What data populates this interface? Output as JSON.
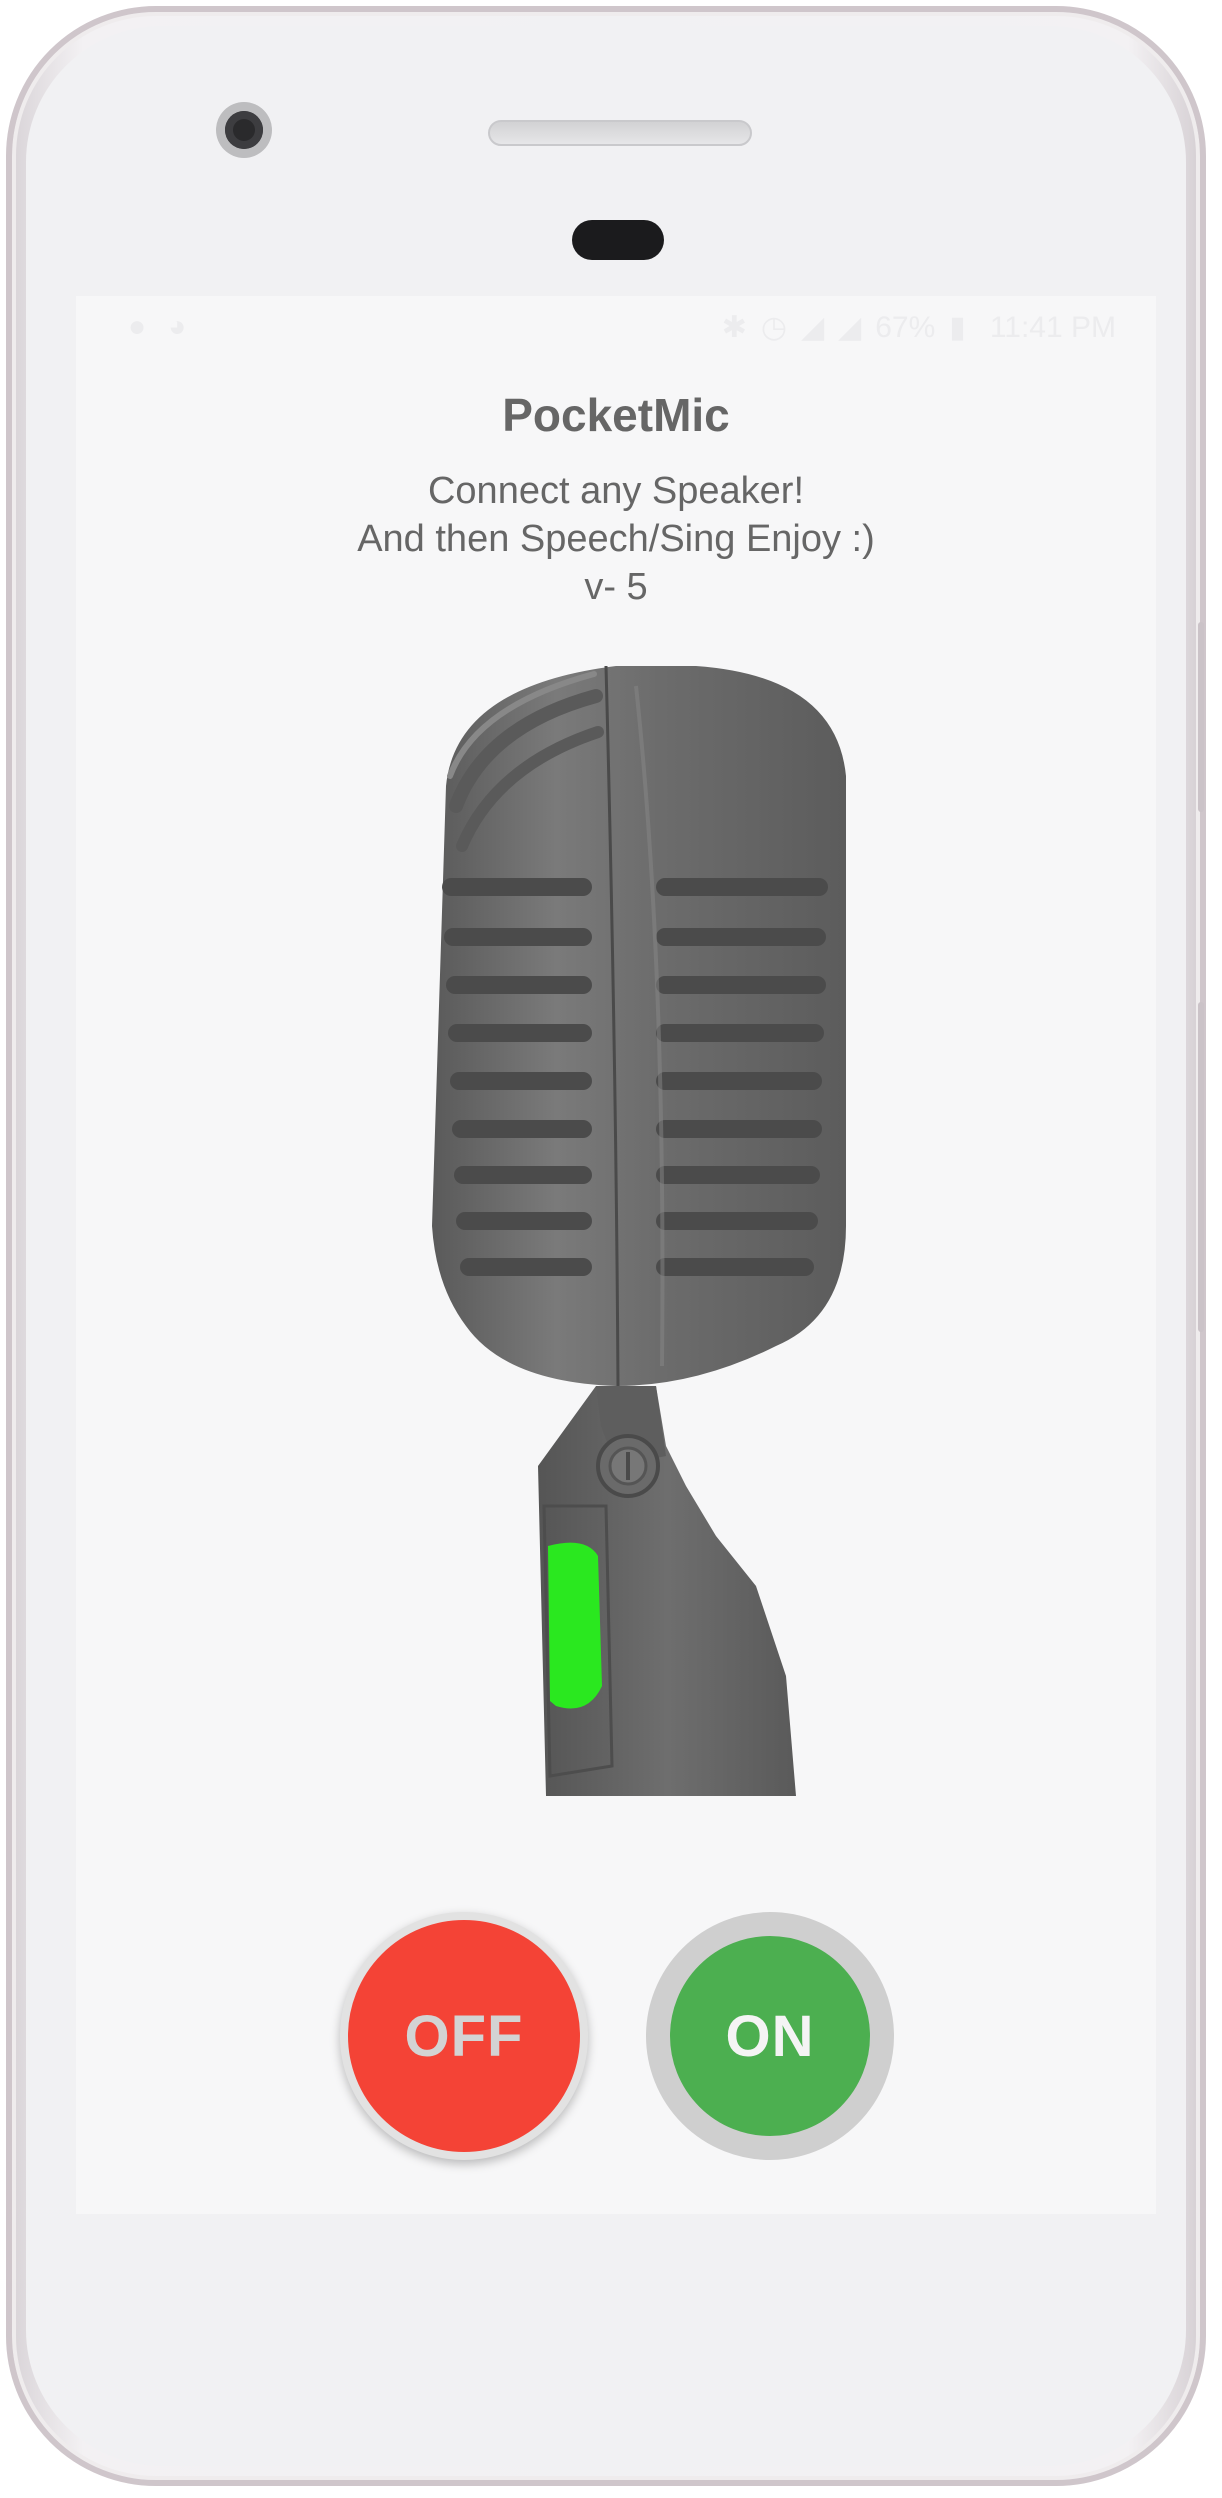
{
  "app": {
    "title": "PocketMic",
    "subtitle_line1": "Connect any Speaker!",
    "subtitle_line2": "And then Speech/Sing Enjoy :)",
    "version": "v- 5"
  },
  "status_bar": {
    "battery_percent": "67%",
    "time": "11:41 PM",
    "icons": [
      "location-icon",
      "notification-icon",
      "bluetooth-icon",
      "alarm-icon",
      "wifi-icon",
      "signal-icon",
      "battery-icon"
    ]
  },
  "controls": {
    "off_label": "OFF",
    "on_label": "ON"
  },
  "colors": {
    "off_button": "#f44336",
    "on_button": "#4caf50",
    "mic_body": "#6b6b6b",
    "mic_indicator": "#2ae81f",
    "text": "#666666"
  }
}
